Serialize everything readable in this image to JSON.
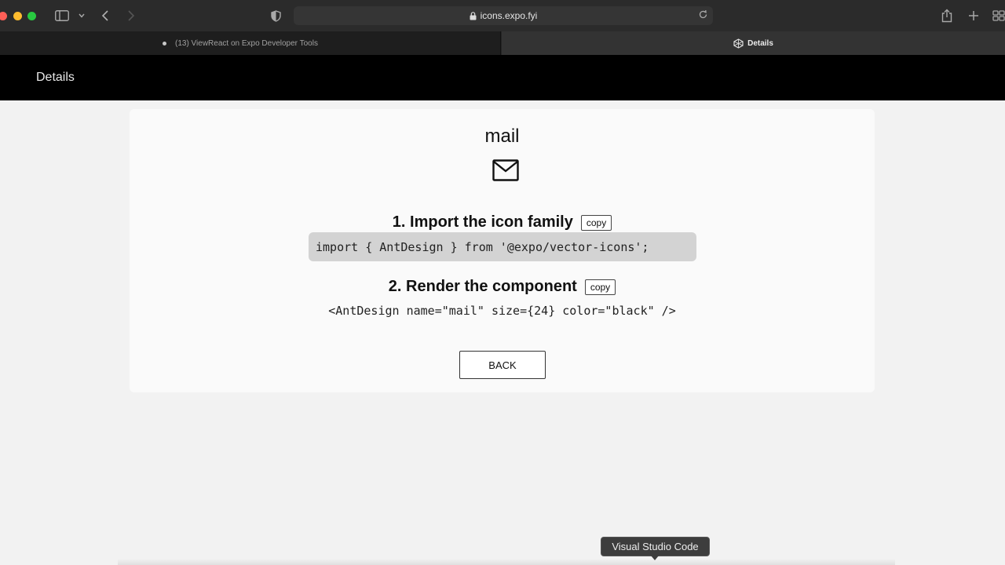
{
  "browser": {
    "url": "icons.expo.fyi",
    "tabs": [
      {
        "label": "(13) ViewReact on Expo Developer Tools"
      },
      {
        "label": "Details"
      }
    ]
  },
  "header": {
    "title": "Details"
  },
  "icon": {
    "name": "mail",
    "glyph": "mail-icon"
  },
  "steps": {
    "import_title": "1. Import the icon family",
    "import_code": "import { AntDesign } from '@expo/vector-icons';",
    "render_title": "2. Render the component",
    "render_code": "<AntDesign name=\"mail\" size={24} color=\"black\" />",
    "copy_label": "copy"
  },
  "back_label": "BACK",
  "dock": {
    "tooltip": "Visual Studio Code"
  }
}
